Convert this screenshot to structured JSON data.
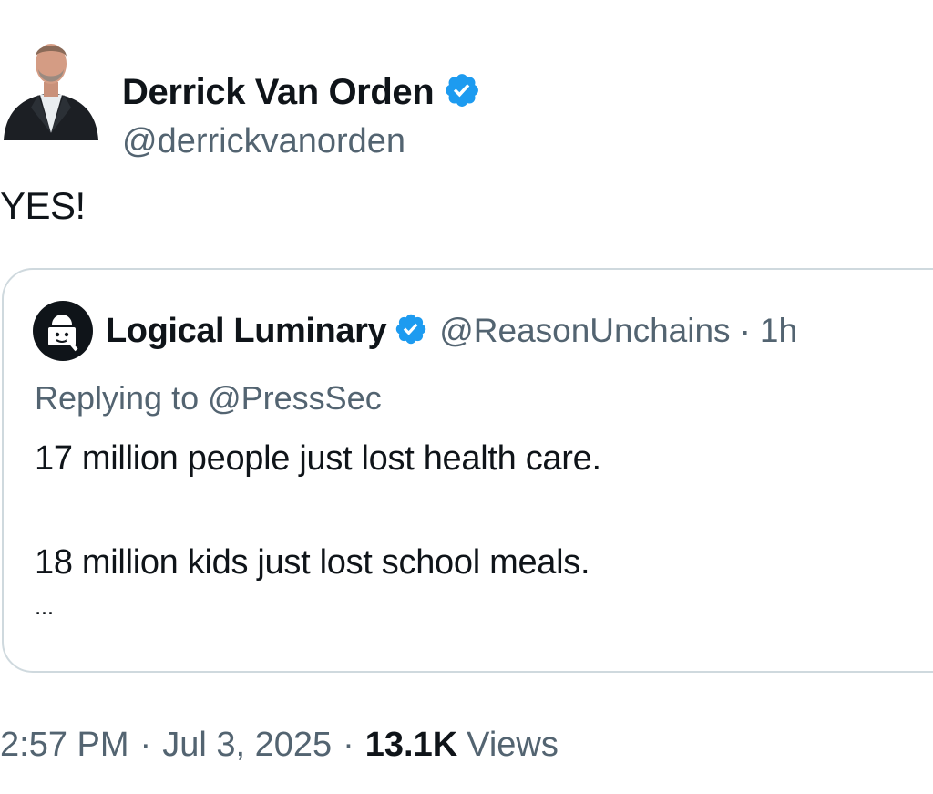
{
  "author": {
    "name": "Derrick Van Orden",
    "handle": "@derrickvanorden",
    "verified_color": "#1d9bf0"
  },
  "tweet": {
    "text": "YES!"
  },
  "quoted_tweet": {
    "name": "Logical Luminary",
    "handle": "@ReasonUnchains",
    "separator": "·",
    "time": "1h",
    "replying_to": "Replying to @PressSec",
    "line1": "17 million people just lost health care.",
    "line2": "18 million kids just lost school meals.",
    "ellipsis": "..."
  },
  "footer": {
    "time": "2:57 PM",
    "separator": "·",
    "date": "Jul 3, 2025",
    "separator2": "·",
    "views_count": "13.1K",
    "views_label": "Views"
  },
  "colors": {
    "secondary_text": "#536471",
    "border": "#cfd9de",
    "primary_text": "#0f1419"
  }
}
